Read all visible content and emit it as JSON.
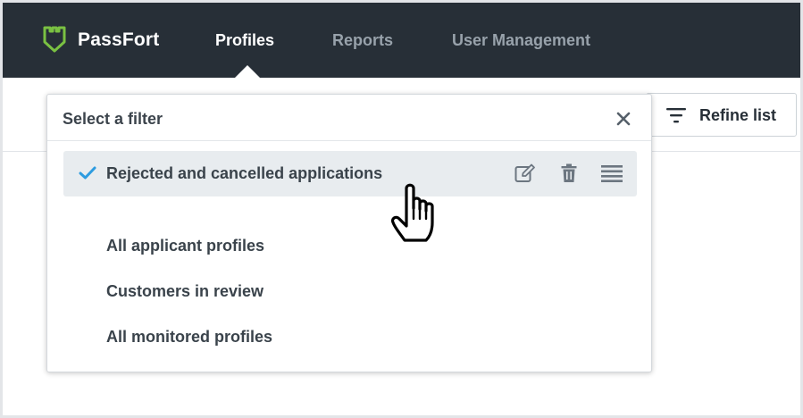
{
  "app": {
    "brand": "PassFort",
    "brand_color": "#7ac142",
    "nav_bg": "#272f37"
  },
  "nav": {
    "items": [
      {
        "label": "Profiles",
        "active": true
      },
      {
        "label": "Reports",
        "active": false
      },
      {
        "label": "User Management",
        "active": false
      }
    ]
  },
  "toolbar": {
    "refine_label": "Refine list",
    "refine_icon": "filter-icon"
  },
  "filter_dropdown": {
    "title": "Select a filter",
    "close_icon": "close-icon",
    "selected": {
      "label": "Rejected and cancelled applications",
      "icons": [
        "check-icon",
        "edit-icon",
        "trash-icon",
        "drag-handle-icon"
      ]
    },
    "items": [
      {
        "label": "All applicant profiles"
      },
      {
        "label": "Customers in review"
      },
      {
        "label": "All monitored profiles"
      }
    ]
  },
  "cursor": "hand-pointer-icon",
  "accent": "#2d9ce0"
}
